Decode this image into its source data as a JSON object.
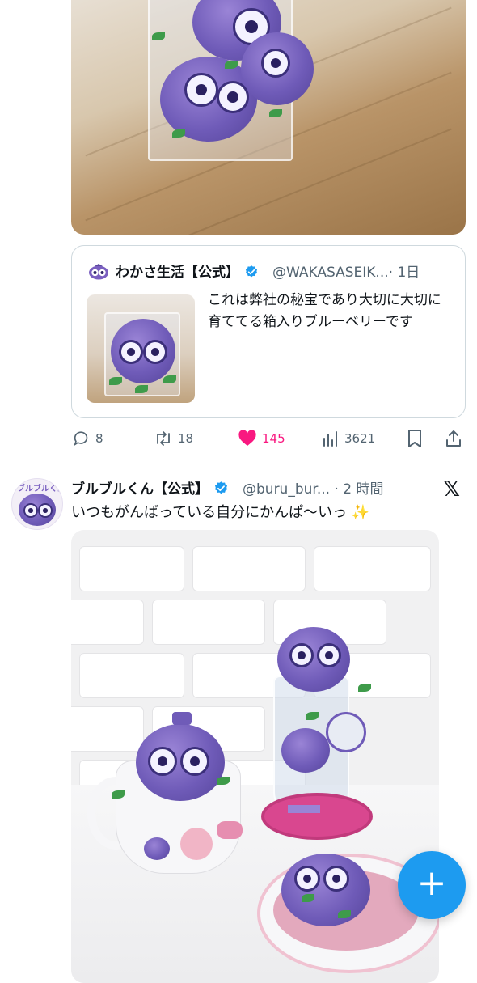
{
  "quoted_tweet": {
    "author_name": "わかさ生活【公式】",
    "handle": "@WAKASASEIK...",
    "time": "· 1日",
    "text": "これは弊社の秘宝であり大切に大切に育ててる箱入りブルーベリーです"
  },
  "actions": {
    "replies": "8",
    "retweets": "18",
    "likes": "145",
    "views": "3621"
  },
  "tweet": {
    "author_name": "ブルブルくん【公式】",
    "handle_time": "@buru_bur... · 2 時間",
    "avatar_text": "ブルブルくん",
    "text": "いつもがんばっている自分にかんぱ〜いっ ✨",
    "brand_mark": "𝕏"
  },
  "fab": {
    "label": "+"
  },
  "colors": {
    "like": "#f91880",
    "accent": "#1d9bf0",
    "verified": "#1d9bf0",
    "muted_text": "#536471"
  }
}
